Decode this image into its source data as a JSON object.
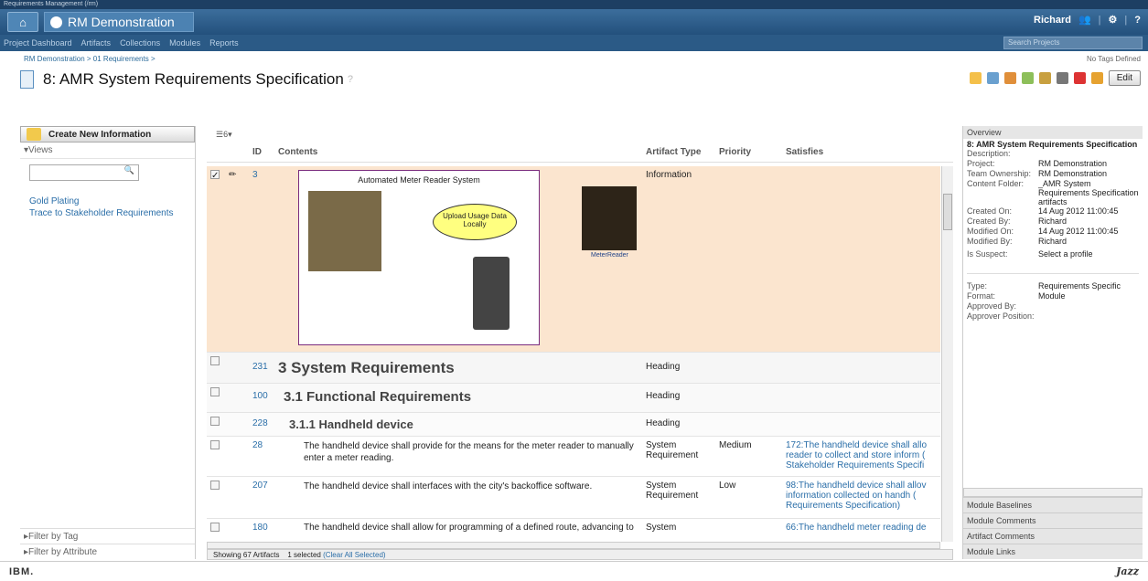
{
  "app_title": "Requirements Management (/rm)",
  "project_name": "RM Demonstration",
  "user_name": "Richard",
  "nav": [
    "Project Dashboard",
    "Artifacts",
    "Collections",
    "Modules",
    "Reports"
  ],
  "search_placeholder": "Search Projects",
  "breadcrumb": "RM Demonstration > 01 Requirements >",
  "tags_text": "No Tags Defined",
  "page_title": "8: AMR System Requirements Specification",
  "edit_label": "Edit",
  "create_label": "Create New Information",
  "views_label": "Views",
  "views": [
    "Gold Plating",
    "Trace to Stakeholder Requirements"
  ],
  "filter_tag": "Filter by Tag",
  "filter_attr": "Filter by Attribute",
  "toolbar_count": "6",
  "columns": {
    "id": "ID",
    "contents": "Contents",
    "type": "Artifact Type",
    "priority": "Priority",
    "satisfies": "Satisfies"
  },
  "diagram": {
    "title": "Automated Meter Reader System",
    "bubble": "Upload Usage Data Locally",
    "actor": "MeterReader"
  },
  "rows": [
    {
      "id": "3",
      "type": "Information",
      "priority": "",
      "sat": ""
    },
    {
      "id": "231",
      "heading": "3 System Requirements",
      "type": "Heading"
    },
    {
      "id": "100",
      "heading": "3.1 Functional Requirements",
      "type": "Heading"
    },
    {
      "id": "228",
      "heading": "3.1.1 Handheld device",
      "type": "Heading"
    },
    {
      "id": "28",
      "text": "The handheld device shall provide for the means for the meter reader to manually enter a meter reading.",
      "type": "System Requirement",
      "priority": "Medium",
      "sat": "172:The handheld device shall allo reader to collect and store inform ( Stakeholder Requirements Specifi"
    },
    {
      "id": "207",
      "text": "The handheld device shall interfaces with the city's backoffice software.",
      "type": "System Requirement",
      "priority": "Low",
      "sat": "98:The handheld device shall allov information collected on handh ( Requirements Specification)"
    },
    {
      "id": "180",
      "text": "The handheld device shall allow for programming of a defined route, advancing to",
      "type": "System",
      "priority": "",
      "sat": "66:The handheld meter reading de"
    }
  ],
  "status": {
    "showing": "Showing 67 Artifacts",
    "selected": "1 selected",
    "clear": "(Clear All Selected)"
  },
  "overview": {
    "header": "Overview",
    "title": "8: AMR System Requirements Specification",
    "props": [
      {
        "k": "Description:",
        "v": ""
      },
      {
        "k": "Project:",
        "v": "RM Demonstration"
      },
      {
        "k": "Team Ownership:",
        "v": "RM Demonstration"
      },
      {
        "k": "Content Folder:",
        "v": "_AMR System Requirements Specification artifacts"
      },
      {
        "k": "Created On:",
        "v": "14 Aug 2012 11:00:45"
      },
      {
        "k": "Created By:",
        "v": "Richard"
      },
      {
        "k": "Modified On:",
        "v": "14 Aug 2012 11:00:45"
      },
      {
        "k": "Modified By:",
        "v": "Richard"
      },
      {
        "k": "Is Suspect:",
        "v": "Select a profile"
      },
      {
        "k": "Type:",
        "v": "Requirements Specific"
      },
      {
        "k": "Format:",
        "v": "Module"
      },
      {
        "k": "Approved By:",
        "v": ""
      },
      {
        "k": "Approver Position:",
        "v": ""
      }
    ]
  },
  "sections": [
    "Module Baselines",
    "Module Comments",
    "Artifact Comments",
    "Module Links"
  ],
  "footer": {
    "ibm": "IBM.",
    "jazz": "Jazz"
  }
}
